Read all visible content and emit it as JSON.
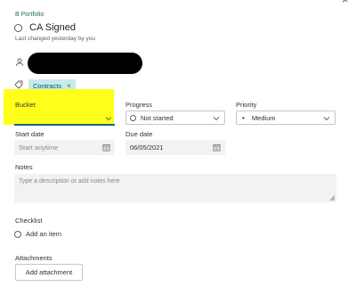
{
  "header": {
    "close_glyph": "×",
    "plan_name": "B Portfolio",
    "task_title": "CA Signed",
    "last_changed": "Last changed yesterday by you"
  },
  "labels": {
    "tag_text": "Contracts",
    "remove_glyph": "×"
  },
  "fields": {
    "bucket_label": "Bucket",
    "bucket_value": "",
    "progress_label": "Progress",
    "progress_value": "Not started",
    "priority_label": "Priority",
    "priority_bullet": "•",
    "priority_value": "Medium",
    "start_label": "Start date",
    "start_placeholder": "Start anytime",
    "due_label": "Due date",
    "due_value": "06/05/2021"
  },
  "notes": {
    "label": "Notes",
    "placeholder": "Type a description or add notes here"
  },
  "checklist": {
    "label": "Checklist",
    "add_item": "Add an item"
  },
  "attachments": {
    "label": "Attachments",
    "button": "Add attachment"
  },
  "colors": {
    "highlight": "#ffff1a",
    "plan_name": "#217346",
    "label_chip_bg": "#c6ece9",
    "bucket_underline": "#1e5e8f"
  },
  "icons": [
    "close-icon",
    "circle-checkbox-icon",
    "person-icon",
    "tag-icon",
    "chevron-down-icon",
    "calendar-icon",
    "resize-handle-icon"
  ]
}
